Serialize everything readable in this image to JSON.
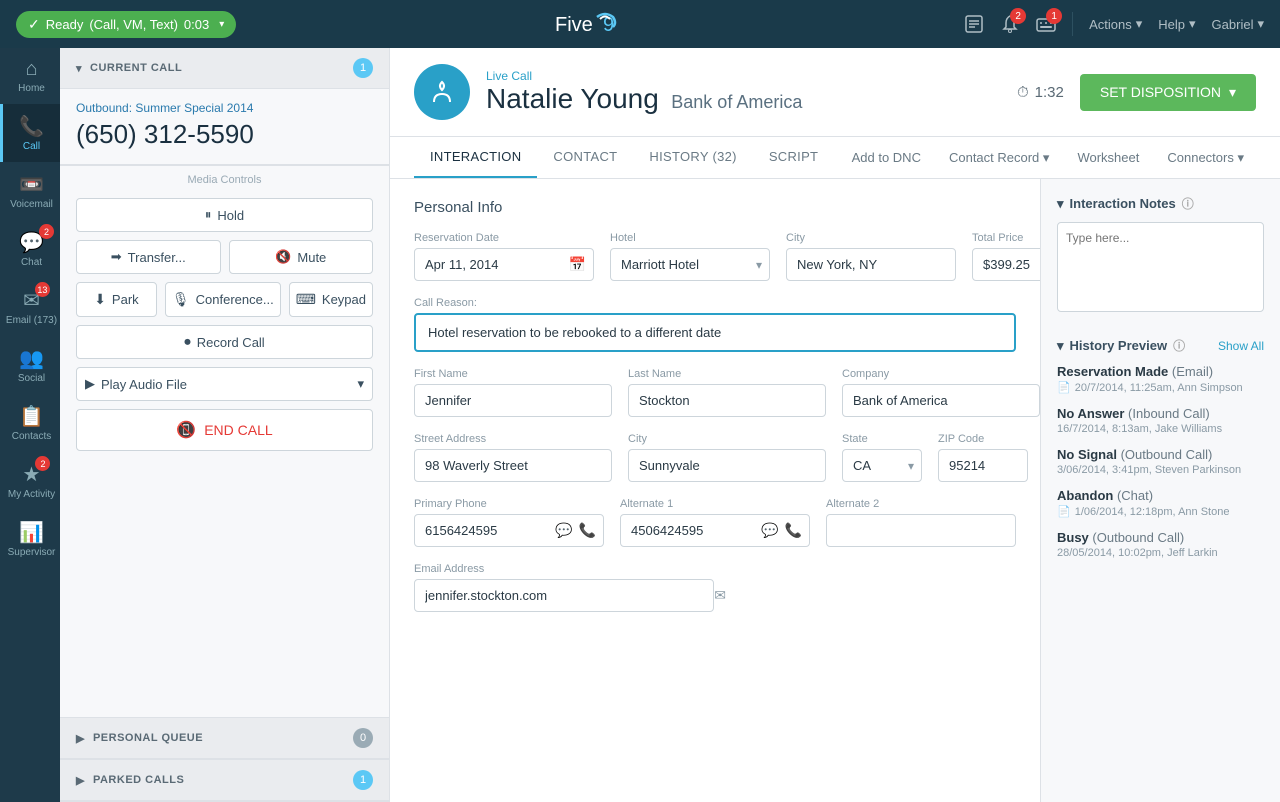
{
  "topNav": {
    "status": "Ready",
    "statusDetail": "(Call, VM, Text)",
    "timer": "0:03",
    "logo": "Five9",
    "actions": "Actions",
    "help": "Help",
    "user": "Gabriel",
    "badge1": "2",
    "badge2": "1"
  },
  "sidebar": {
    "items": [
      {
        "id": "home",
        "label": "Home",
        "icon": "⌂",
        "active": false
      },
      {
        "id": "call",
        "label": "Call",
        "icon": "📞",
        "active": true
      },
      {
        "id": "voicemail",
        "label": "Voicemail",
        "icon": "📼",
        "badge": null,
        "active": false
      },
      {
        "id": "chat",
        "label": "Chat",
        "icon": "💬",
        "badge": "2",
        "active": false
      },
      {
        "id": "email",
        "label": "Email (173)",
        "icon": "✉",
        "badge": "13",
        "active": false
      },
      {
        "id": "social",
        "label": "Social",
        "icon": "👥",
        "active": false
      },
      {
        "id": "contacts",
        "label": "Contacts",
        "icon": "📋",
        "active": false
      },
      {
        "id": "myactivity",
        "label": "My Activity",
        "icon": "★",
        "badge": "2",
        "active": false
      },
      {
        "id": "supervisor",
        "label": "Supervisor",
        "icon": "📊",
        "active": false
      }
    ]
  },
  "leftPanel": {
    "currentCall": {
      "title": "CURRENT CALL",
      "count": "1",
      "outboundLabel": "Outbound:",
      "campaign": "Summer Special 2014",
      "phone": "(650) 312-5590"
    },
    "mediaControls": "Media Controls",
    "buttons": {
      "hold": "Hold",
      "transfer": "Transfer...",
      "mute": "Mute",
      "park": "Park",
      "conference": "Conference...",
      "keypad": "Keypad",
      "recordCall": "Record Call",
      "playAudio": "Play Audio File",
      "endCall": "END CALL"
    },
    "personalQueue": {
      "title": "PERSONAL QUEUE",
      "count": "0"
    },
    "parkedCalls": {
      "title": "PARKED CALLS",
      "count": "1"
    }
  },
  "contactHeader": {
    "liveCallLabel": "Live Call",
    "name": "Natalie Young",
    "company": "Bank of America",
    "timer": "1:32",
    "setDisposition": "SET DISPOSITION"
  },
  "tabs": {
    "items": [
      {
        "id": "interaction",
        "label": "INTERACTION",
        "active": true
      },
      {
        "id": "contact",
        "label": "CONTACT",
        "active": false
      },
      {
        "id": "history",
        "label": "HISTORY (32)",
        "active": false
      },
      {
        "id": "script",
        "label": "SCRIPT",
        "active": false
      }
    ],
    "actions": [
      "Add to DNC",
      "Contact Record",
      "Worksheet",
      "Connectors"
    ]
  },
  "form": {
    "sectionTitle": "Personal Info",
    "fields": {
      "reservationDateLabel": "Reservation Date",
      "reservationDate": "Apr 11, 2014",
      "hotelLabel": "Hotel",
      "hotel": "Marriott Hotel",
      "cityLabel": "City",
      "city": "New York, NY",
      "totalPriceLabel": "Total Price",
      "totalPrice": "$399.25",
      "callReasonLabel": "Call Reason:",
      "callReason": "Hotel reservation to be rebooked to a different date",
      "firstNameLabel": "First Name",
      "firstName": "Jennifer",
      "lastNameLabel": "Last Name",
      "lastName": "Stockton",
      "companyLabel": "Company",
      "company": "Bank of America",
      "streetAddressLabel": "Street Address",
      "streetAddress": "98 Waverly Street",
      "cityFieldLabel": "City",
      "cityField": "Sunnyvale",
      "stateLabel": "State",
      "state": "CA",
      "zipCodeLabel": "ZIP Code",
      "zipCode": "95214",
      "primaryPhoneLabel": "Primary Phone",
      "primaryPhone": "6156424595",
      "alternate1Label": "Alternate 1",
      "alternate1": "4506424595",
      "alternate2Label": "Alternate 2",
      "alternate2": "",
      "emailLabel": "Email Address",
      "email": "jennifer.stockton.com"
    }
  },
  "rightPanel": {
    "interactionNotes": {
      "title": "Interaction Notes",
      "placeholder": "Type here..."
    },
    "historyPreview": {
      "title": "History Preview",
      "showAll": "Show All",
      "items": [
        {
          "type": "Reservation Made",
          "channel": "Email",
          "date": "20/7/2014, 11:25am,",
          "agent": "Ann Simpson",
          "hasDoc": true
        },
        {
          "type": "No Answer",
          "channel": "Inbound Call",
          "date": "16/7/2014, 8:13am,",
          "agent": "Jake Williams",
          "hasDoc": false
        },
        {
          "type": "No Signal",
          "channel": "Outbound Call",
          "date": "3/06/2014, 3:41pm,",
          "agent": "Steven Parkinson",
          "hasDoc": false
        },
        {
          "type": "Abandon",
          "channel": "Chat",
          "date": "1/06/2014, 12:18pm,",
          "agent": "Ann Stone",
          "hasDoc": true
        },
        {
          "type": "Busy",
          "channel": "Outbound Call",
          "date": "28/05/2014, 10:02pm,",
          "agent": "Jeff Larkin",
          "hasDoc": false
        }
      ]
    }
  }
}
